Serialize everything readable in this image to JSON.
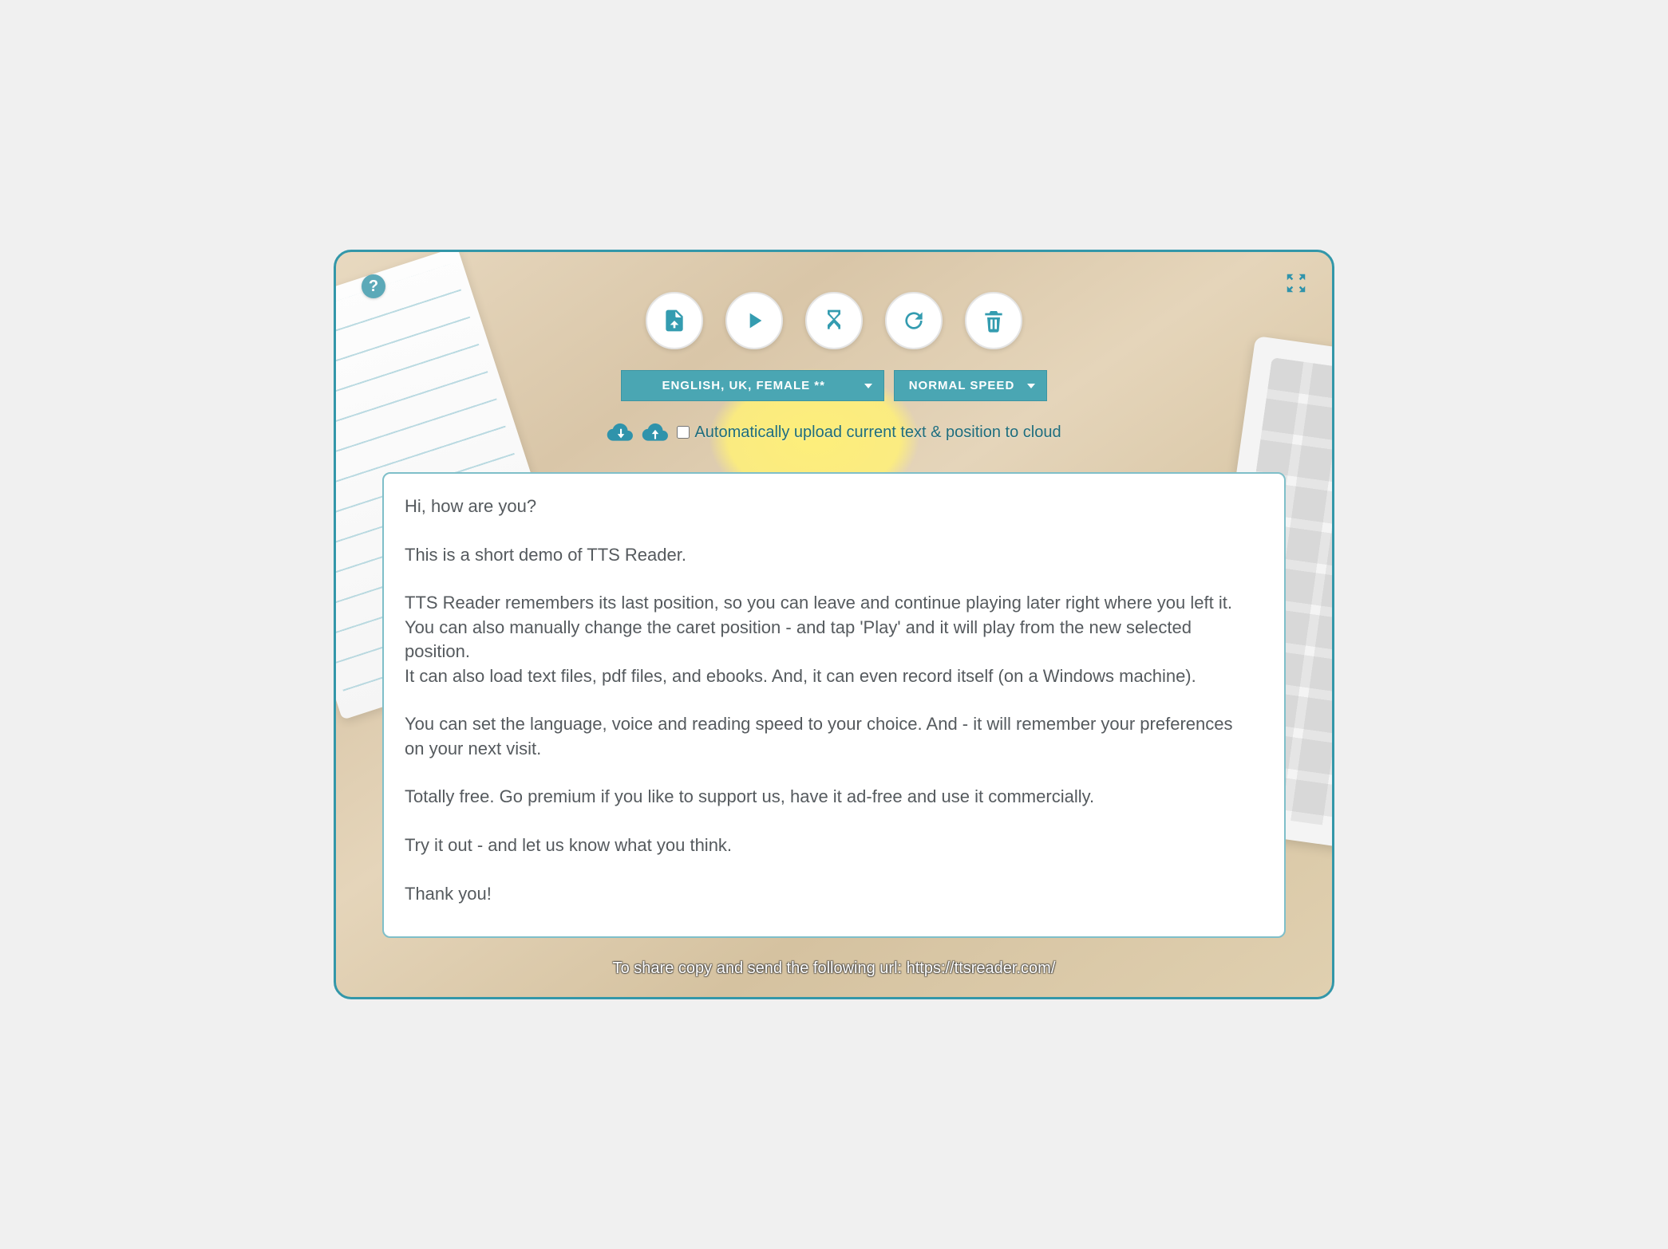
{
  "corner": {
    "help_tooltip": "Help",
    "expand_tooltip": "Fullscreen"
  },
  "toolbar": {
    "upload_tooltip": "Upload text / file",
    "play_tooltip": "Play",
    "timer_tooltip": "Sleep timer",
    "reset_tooltip": "Reset to start",
    "clear_tooltip": "Clear text"
  },
  "selects": {
    "voice": "English, UK, Female **",
    "speed": "Normal Speed"
  },
  "cloud": {
    "download_tooltip": "Download from cloud",
    "upload_tooltip": "Upload to cloud",
    "auto_label": "Automatically upload current text & position to cloud",
    "auto_checked": false
  },
  "editor": {
    "text": "Hi, how are you?\n\nThis is a short demo of TTS Reader.\n\nTTS Reader remembers its last position, so you can leave and continue playing later right where you left it.\nYou can also manually change the caret position - and tap 'Play' and it will play from the new selected position.\nIt can also load text files, pdf files, and ebooks. And, it can even record itself (on a Windows machine).\n\nYou can set the language, voice and reading speed to your choice. And - it will remember your preferences on your next visit.\n\nTotally free. Go premium if you like to support us, have it ad-free and use it commercially.\n\nTry it out - and let us know what you think.\n\nThank you!"
  },
  "footer": {
    "share_text": "To share copy and send the following url: https://ttsreader.com/"
  }
}
